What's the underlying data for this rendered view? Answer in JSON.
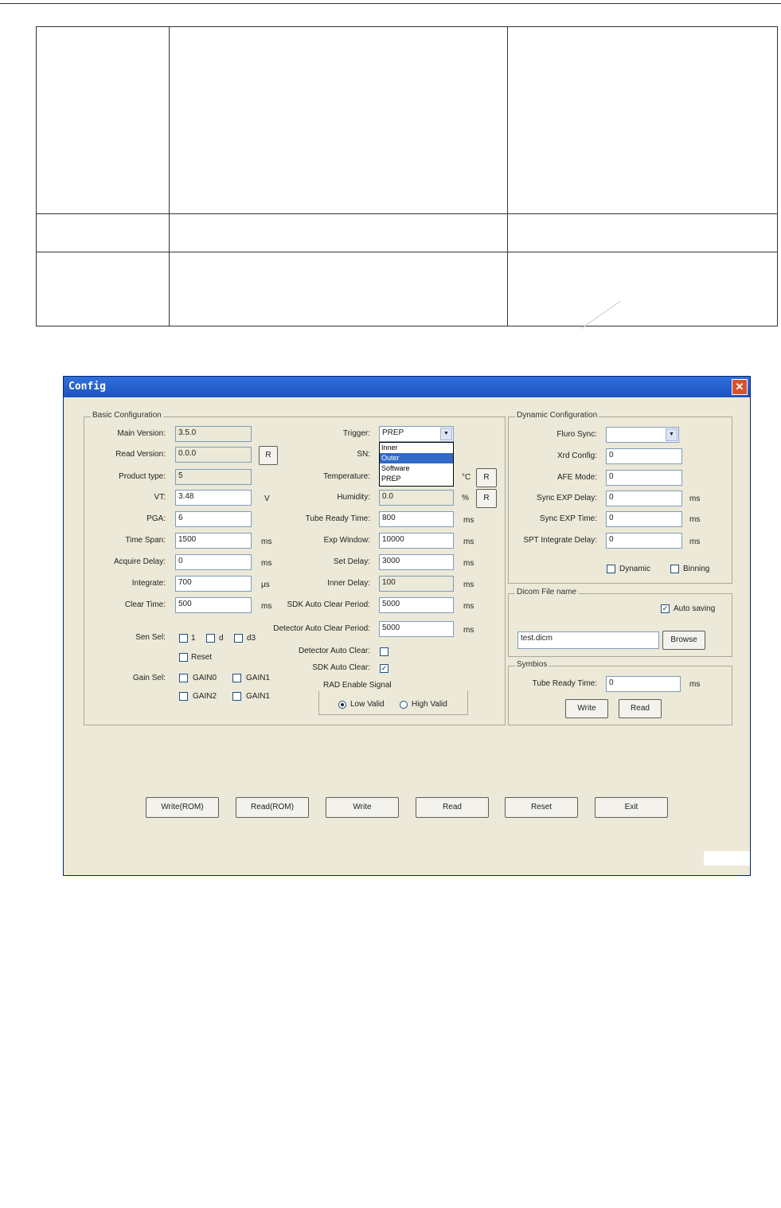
{
  "window": {
    "title": "Config",
    "close_glyph": "✕"
  },
  "basic": {
    "title": "Basic Configuration",
    "rows": [
      {
        "label": "Main Version:",
        "value": "3.5.0"
      },
      {
        "label": "Read Version:",
        "value": "0.0.0"
      },
      {
        "label": "Product type:",
        "value": "5"
      },
      {
        "label": "VT:",
        "value": "3.48",
        "unit": "V"
      },
      {
        "label": "PGA:",
        "value": "6"
      },
      {
        "label": "Time Span:",
        "value": "1500",
        "unit": "ms"
      },
      {
        "label": "Acquire Delay:",
        "value": "0",
        "unit": "ms"
      },
      {
        "label": "Integrate:",
        "value": "700",
        "unit": "µs"
      },
      {
        "label": "Clear Time:",
        "value": "500",
        "unit": "ms"
      }
    ],
    "read_button": "R",
    "sen_sel": {
      "label": "Sen Sel:",
      "opts": [
        "1",
        "d",
        "d3"
      ],
      "reset": "Reset"
    },
    "gain_sel": {
      "label": "Gain Sel:",
      "opts": [
        "GAIN0",
        "GAIN1",
        "GAIN2",
        "GAIN1"
      ]
    }
  },
  "middle": {
    "trigger": {
      "label": "Trigger:",
      "value": "PREP",
      "options": [
        "Inner",
        "Outer",
        "Software",
        "PREP"
      ],
      "selected_index": 1
    },
    "sn_label": "SN:",
    "temperature": {
      "label": "Temperature:",
      "unit": "°C",
      "button": "R"
    },
    "humidity": {
      "label": "Humidity:",
      "value": "0.0",
      "unit": "%",
      "button": "R"
    },
    "rows": [
      {
        "label": "Tube Ready Time:",
        "value": "800",
        "unit": "ms"
      },
      {
        "label": "Exp Window:",
        "value": "10000",
        "unit": "ms"
      },
      {
        "label": "Set Delay:",
        "value": "3000",
        "unit": "ms"
      },
      {
        "label": "Inner Delay:",
        "value": "100",
        "unit": "ms"
      },
      {
        "label": "SDK Auto Clear Period:",
        "value": "5000",
        "unit": "ms"
      },
      {
        "label": "Detector Auto Clear Period:",
        "value": "5000",
        "unit": "ms"
      }
    ],
    "detector_auto_clear": "Detector Auto Clear:",
    "sdk_auto_clear": "SDK Auto Clear:",
    "rad_enable": {
      "label": "RAD Enable Signal",
      "low": "Low Valid",
      "high": "High Valid"
    }
  },
  "dynamic": {
    "title": "Dynamic Configuration",
    "fluro_sync": "Fluro Sync:",
    "rows": [
      {
        "label": "Xrd Config:",
        "value": "0"
      },
      {
        "label": "AFE Mode:",
        "value": "0"
      },
      {
        "label": "Sync EXP Delay:",
        "value": "0",
        "unit": "ms"
      },
      {
        "label": "Sync EXP Time:",
        "value": "0",
        "unit": "ms"
      },
      {
        "label": "SPT Integrate Delay:",
        "value": "0",
        "unit": "ms"
      }
    ],
    "dynamic_cb": "Dynamic",
    "binning_cb": "Binning"
  },
  "dicom": {
    "title": "Dicom File name",
    "autosaving": "Auto saving",
    "file": "test.dicm",
    "browse": "Browse"
  },
  "symbios": {
    "title": "Symbios",
    "label": "Tube Ready Time:",
    "value": "0",
    "unit": "ms",
    "write": "Write",
    "read": "Read"
  },
  "bottom": [
    "Write(ROM)",
    "Read(ROM)",
    "Write",
    "Read",
    "Reset",
    "Exit"
  ]
}
